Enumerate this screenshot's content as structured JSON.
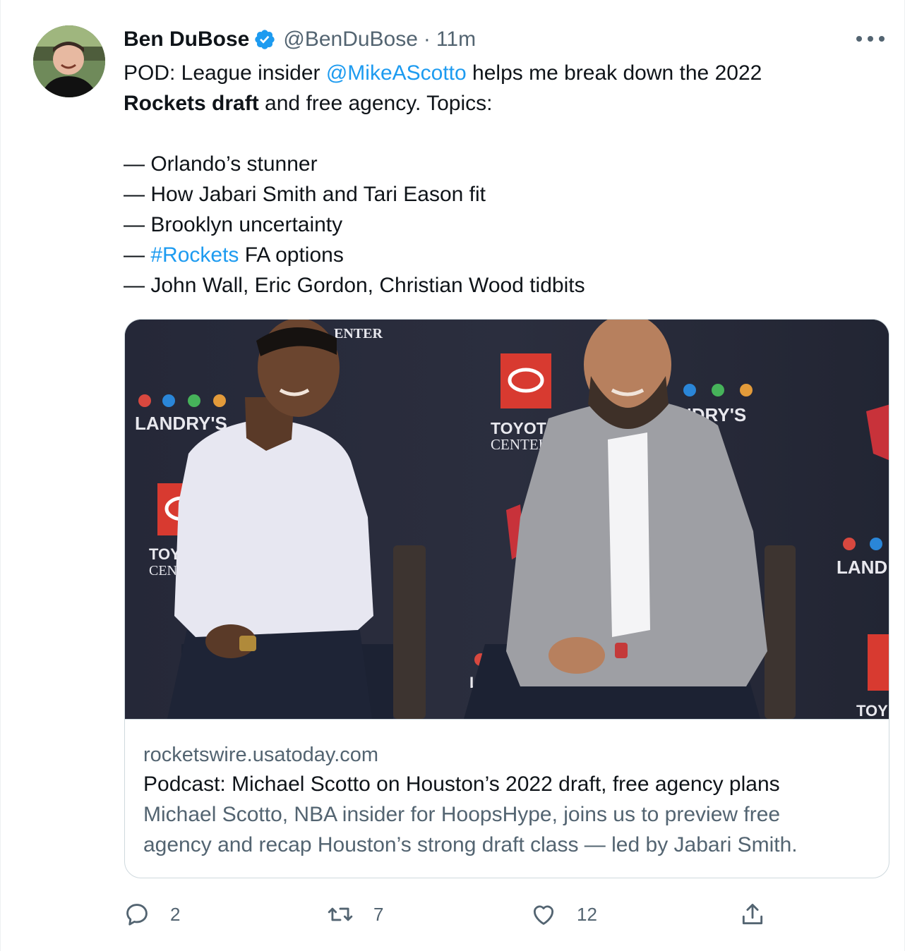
{
  "author": {
    "name": "Ben DuBose",
    "handle": "@BenDuBose",
    "separator": "·",
    "time": "11m",
    "avatar_icon": "user-avatar"
  },
  "tweet": {
    "line1_pre": "POD: League insider ",
    "line1_mention": "@MikeAScotto",
    "line1_post": " helps me break down the 2022",
    "line2_bold": "Rockets draft",
    "line2_post": " and free agency. Topics:",
    "bullets": [
      {
        "dash": "— ",
        "text": "Orlando’s stunner"
      },
      {
        "dash": "— ",
        "text": "How Jabari Smith and Tari Eason fit"
      },
      {
        "dash": "— ",
        "text": "Brooklyn uncertainty"
      },
      {
        "dash": "— ",
        "hashtag": "#Rockets",
        "text": " FA options"
      },
      {
        "dash": "— ",
        "text": "John Wall, Eric Gordon, Christian Wood tidbits"
      }
    ]
  },
  "photo": {
    "backdrop_text": {
      "center_top": "ENTER",
      "landrys_left": "LANDRY'S",
      "landrys_right": "NDRY'S",
      "toyota": "TOYOTA",
      "center": "CENTER",
      "toy_left": "TOY",
      "cen_left": "CEN",
      "land_right": "LAND",
      "toy_right": "TOY",
      "la_bottom": "LA"
    }
  },
  "card": {
    "domain": "rocketswire.usatoday.com",
    "title": "Podcast: Michael Scotto on Houston’s 2022 draft, free agency plans",
    "description_line1": "Michael Scotto, NBA insider for HoopsHype, joins us to preview free",
    "description_line2": "agency and recap Houston’s strong draft class — led by Jabari Smith."
  },
  "actions": {
    "reply_count": "2",
    "retweet_count": "7",
    "like_count": "12"
  },
  "colors": {
    "accent": "#1d9bf0",
    "secondary_text": "#536471",
    "primary_text": "#0f1419",
    "border": "#cfd9de"
  }
}
